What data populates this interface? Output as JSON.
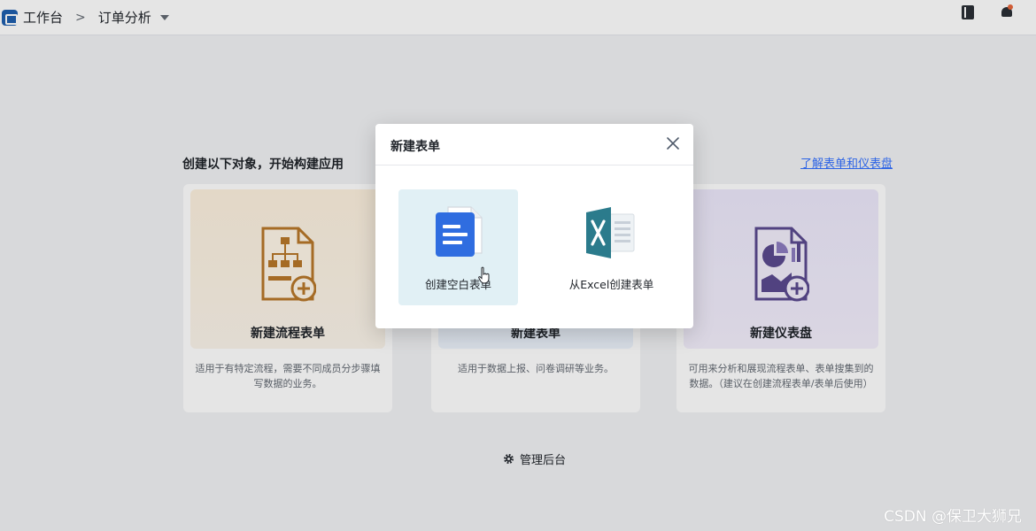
{
  "topbar": {
    "home": "工作台",
    "separator": ">",
    "current": "订单分析"
  },
  "main": {
    "title": "创建以下对象，开始构建应用",
    "learn_link": "了解表单和仪表盘",
    "cards": [
      {
        "title": "新建流程表单",
        "desc": "适用于有特定流程，需要不同成员分步骤填写数据的业务。",
        "icon": "flow-form-icon"
      },
      {
        "title": "新建表单",
        "desc": "适用于数据上报、问卷调研等业务。",
        "icon": "form-icon"
      },
      {
        "title": "新建仪表盘",
        "desc": "可用来分析和展现流程表单、表单搜集到的数据。（建议在创建流程表单/表单后使用）",
        "icon": "dashboard-icon"
      }
    ],
    "admin_label": "管理后台"
  },
  "modal": {
    "title": "新建表单",
    "options": [
      {
        "label": "创建空白表单",
        "icon": "blank-doc-icon"
      },
      {
        "label": "从Excel创建表单",
        "icon": "excel-icon"
      }
    ]
  },
  "watermark": "CSDN @保卫大狮兄",
  "colors": {
    "accent": "#3370ff",
    "selected_option_bg": "#e1f0f5",
    "doc_blue": "#2f6de0",
    "excel_teal": "#2b7b8c",
    "flow_orange": "#b8782a",
    "dashboard_purple": "#5b4a8f"
  }
}
